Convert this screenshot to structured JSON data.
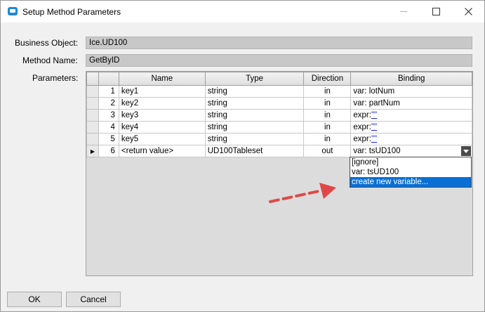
{
  "window": {
    "title": "Setup Method Parameters"
  },
  "form": {
    "business_object_label": "Business Object:",
    "business_object_value": "Ice.UD100",
    "method_name_label": "Method Name:",
    "method_name_value": "GetByID",
    "parameters_label": "Parameters:"
  },
  "grid": {
    "columns": [
      "Name",
      "Type",
      "Direction",
      "Binding"
    ],
    "rows": [
      {
        "index": "1",
        "name": "key1",
        "type": "string",
        "direction": "in",
        "binding": "var: lotNum"
      },
      {
        "index": "2",
        "name": "key2",
        "type": "string",
        "direction": "in",
        "binding": "var: partNum"
      },
      {
        "index": "3",
        "name": "key3",
        "type": "string",
        "direction": "in",
        "binding_prefix": "expr:",
        "binding_link": "\"\""
      },
      {
        "index": "4",
        "name": "key4",
        "type": "string",
        "direction": "in",
        "binding_prefix": "expr:",
        "binding_link": "\"\""
      },
      {
        "index": "5",
        "name": "key5",
        "type": "string",
        "direction": "in",
        "binding_prefix": "expr:",
        "binding_link": "\"\""
      },
      {
        "index": "6",
        "name": "<return value>",
        "type": "UD100Tableset",
        "direction": "out",
        "binding": "var: tsUD100"
      }
    ]
  },
  "dropdown": {
    "options": [
      "[ignore]",
      "var: tsUD100",
      "create new variable..."
    ],
    "highlighted": "create new variable..."
  },
  "buttons": {
    "ok": "OK",
    "cancel": "Cancel"
  },
  "colors": {
    "highlight": "#0a6fd4",
    "annotation_arrow": "#e04848"
  }
}
